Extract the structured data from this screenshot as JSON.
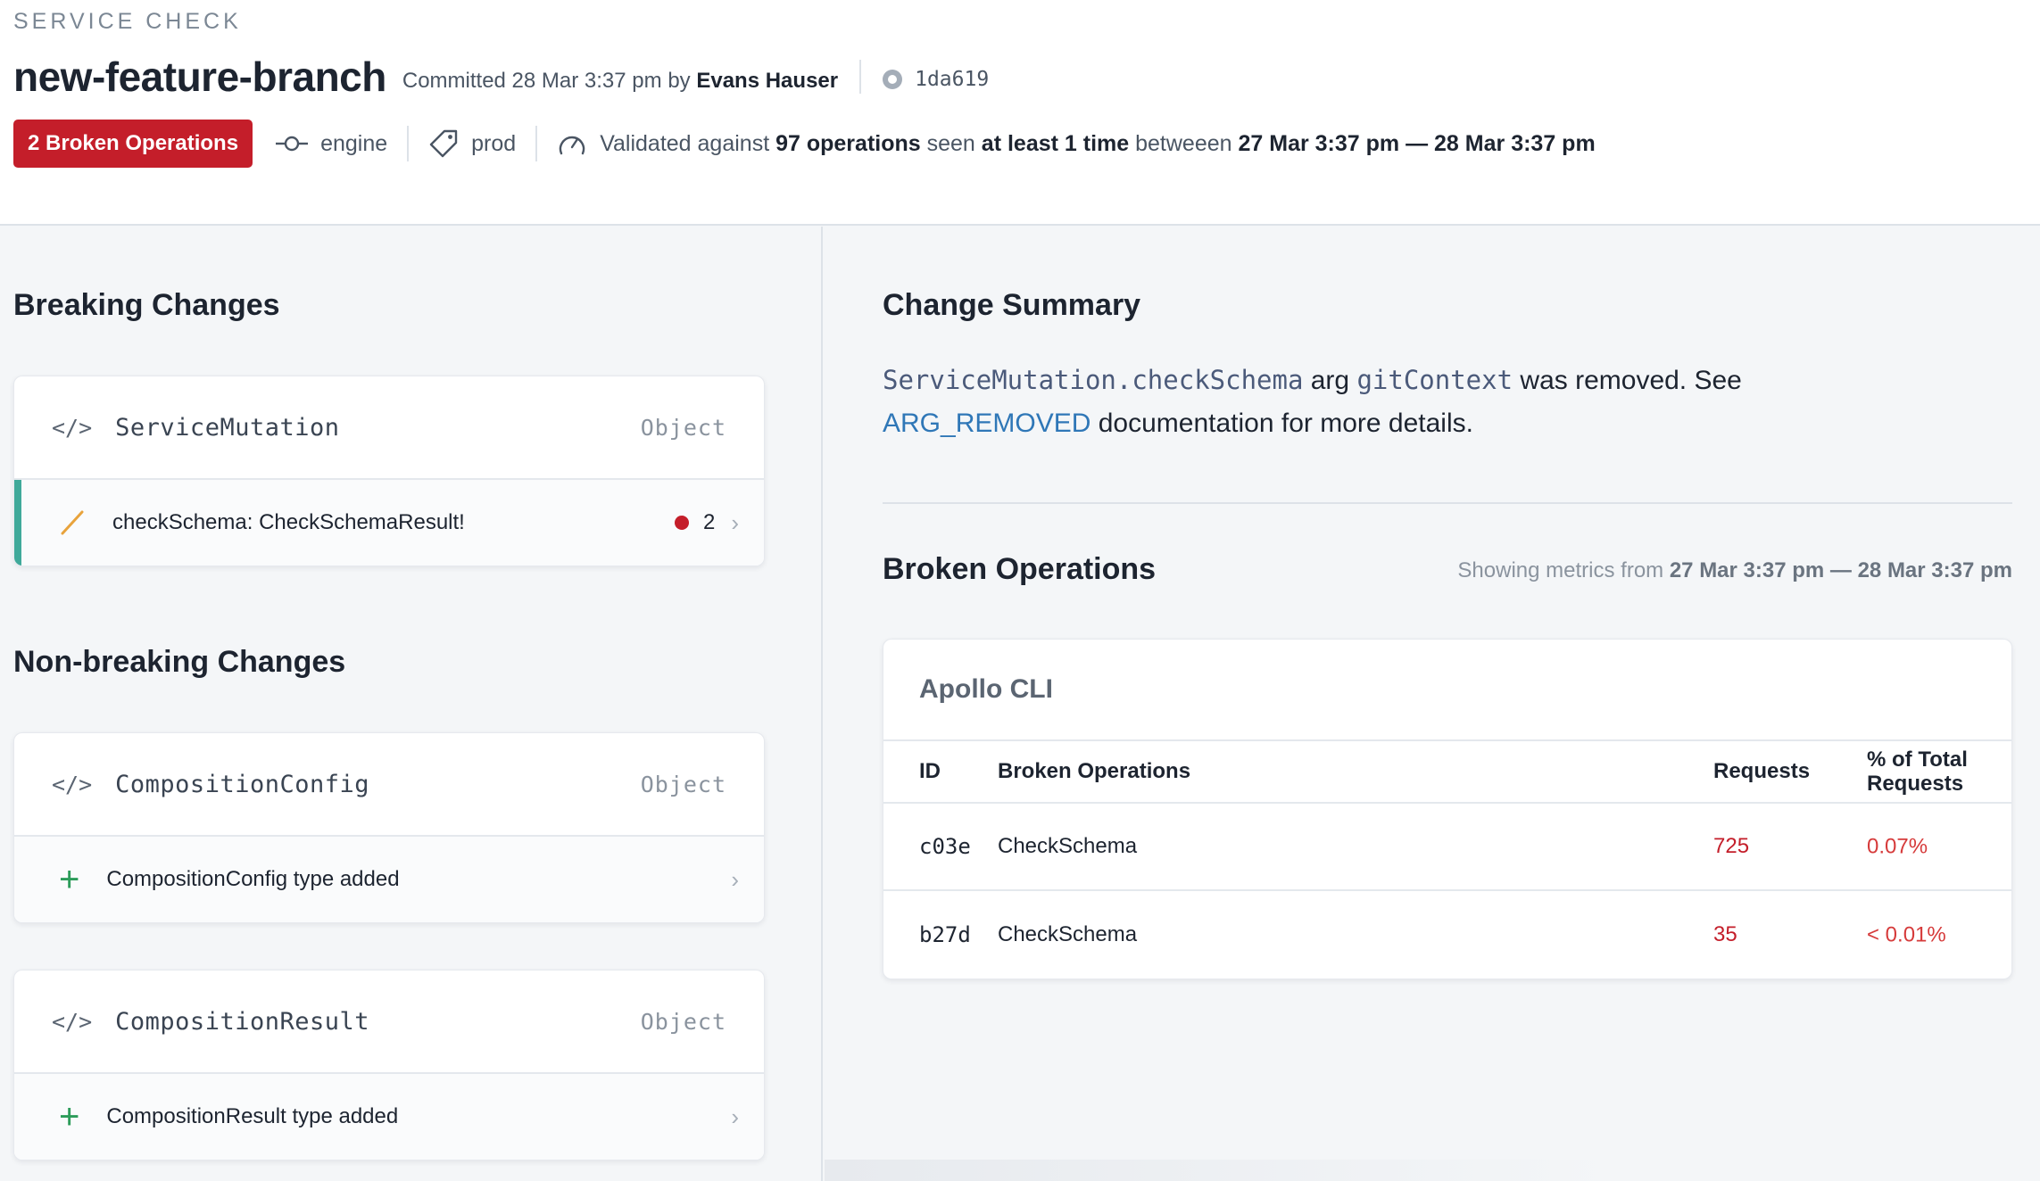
{
  "header": {
    "eyebrow": "SERVICE CHECK",
    "branch": "new-feature-branch",
    "committed_prefix": "Committed 28 Mar 3:37 pm",
    "by_word": "by",
    "author": "Evans Hauser",
    "commit_hash": "1da619",
    "badge": "2 Broken Operations",
    "engine_label": "engine",
    "env_label": "prod",
    "validated": {
      "prefix": "Validated against",
      "count": "97 operations",
      "seen": "seen",
      "threshold": "at least 1 time",
      "between": "betweeen",
      "range": "27 Mar 3:37 pm — 28 Mar 3:37 pm"
    }
  },
  "breaking": {
    "title": "Breaking Changes",
    "cards": [
      {
        "code_icon": "</>",
        "type_name": "ServiceMutation",
        "kind": "Object",
        "row_text": "checkSchema: CheckSchemaResult!",
        "count": "2"
      }
    ]
  },
  "nonbreaking": {
    "title": "Non-breaking Changes",
    "cards": [
      {
        "code_icon": "</>",
        "type_name": "CompositionConfig",
        "kind": "Object",
        "row_text": "CompositionConfig type added"
      },
      {
        "code_icon": "</>",
        "type_name": "CompositionResult",
        "kind": "Object",
        "row_text": "CompositionResult type added"
      }
    ]
  },
  "summary": {
    "title": "Change Summary",
    "field": "ServiceMutation.checkSchema",
    "arg_word": "arg",
    "arg_name": "gitContext",
    "removed_text": "was removed. See",
    "link": "ARG_REMOVED",
    "rest": "documentation for more details."
  },
  "broken_ops": {
    "title": "Broken Operations",
    "showing_prefix": "Showing metrics from",
    "showing_range": "27 Mar 3:37 pm — 28 Mar 3:37 pm",
    "client": "Apollo CLI",
    "columns": {
      "id": "ID",
      "op": "Broken Operations",
      "requests": "Requests",
      "pct_line1": "% of Total",
      "pct_line2": "Requests"
    },
    "rows": [
      {
        "id": "c03e",
        "op": "CheckSchema",
        "requests": "725",
        "pct": "0.07%"
      },
      {
        "id": "b27d",
        "op": "CheckSchema",
        "requests": "35",
        "pct": "< 0.01%"
      }
    ]
  },
  "colors": {
    "badge_red": "#c41e2a",
    "accent_teal": "#3fa99a",
    "link_blue": "#2f77b7",
    "add_green": "#2c9c5a",
    "pencil_orange": "#e8a33c"
  },
  "icons": [
    "commit-icon",
    "tag-icon",
    "gauge-icon",
    "github-icon",
    "code-icon",
    "pencil-icon",
    "plus-icon",
    "chevron-right-icon"
  ]
}
